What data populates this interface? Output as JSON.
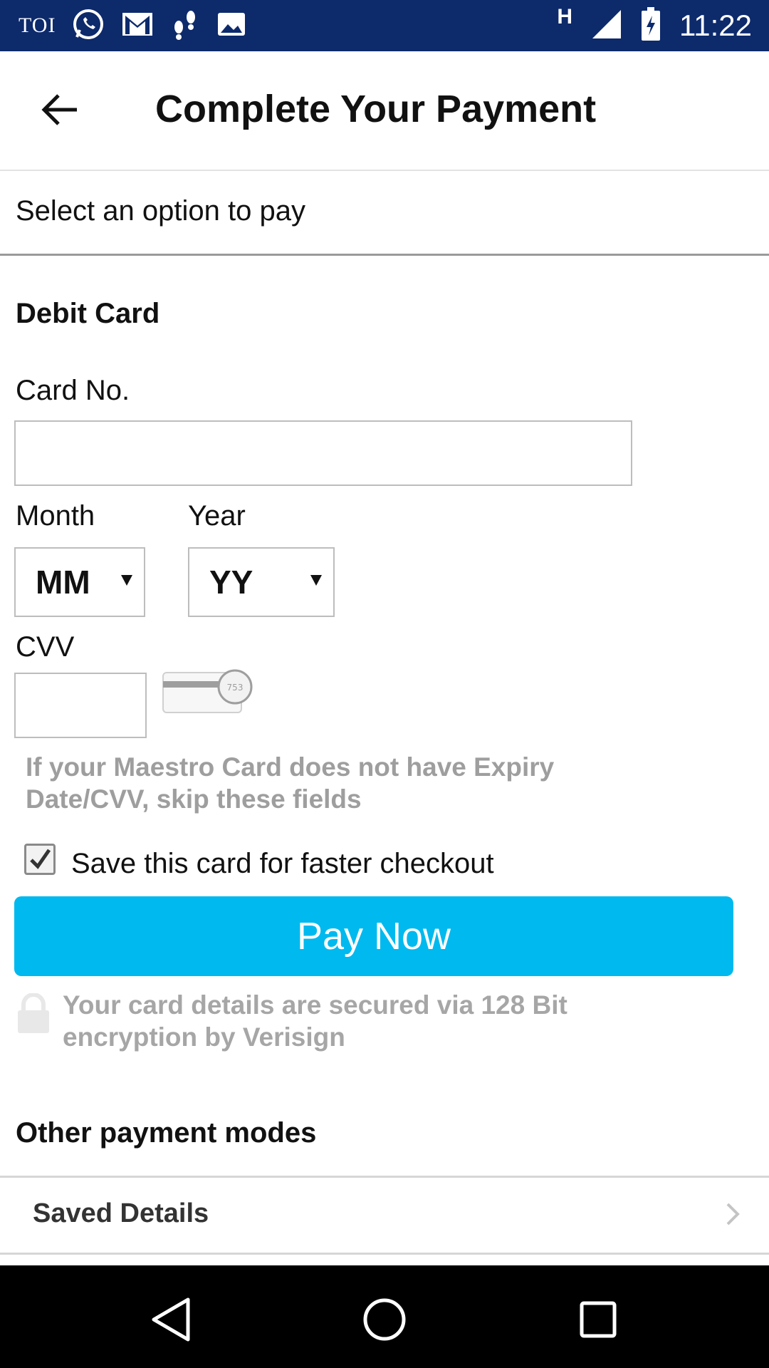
{
  "status_bar": {
    "app_label": "TOI",
    "network_type": "H",
    "time": "11:22",
    "icons": [
      "whatsapp-icon",
      "gmail-icon",
      "footsteps-icon",
      "image-icon",
      "signal-icon",
      "battery-charging-icon"
    ]
  },
  "header": {
    "title": "Complete Your Payment",
    "back_icon": "arrow-left-icon"
  },
  "instructions": "Select an option to pay",
  "debit_card": {
    "section_title": "Debit Card",
    "card_no_label": "Card No.",
    "card_no_value": "",
    "month_label": "Month",
    "month_value": "MM",
    "year_label": "Year",
    "year_value": "YY",
    "cvv_label": "CVV",
    "cvv_value": "",
    "cvv_hint_text": "753",
    "maestro_note": "If your Maestro Card does not have Expiry Date/CVV, skip these fields",
    "save_card_label": "Save this card for faster checkout",
    "save_card_checked": true,
    "pay_button_label": "Pay Now",
    "security_note": "Your card details are secured via 128 Bit encryption by Verisign"
  },
  "other_modes": {
    "title": "Other payment modes",
    "items": [
      {
        "label": "Saved Details"
      }
    ]
  },
  "nav_bar": {
    "buttons": [
      "back-triangle-icon",
      "home-circle-icon",
      "recents-square-icon"
    ]
  },
  "colors": {
    "status_bar": "#0d2a6b",
    "pay_button": "#00b9ee",
    "muted_text": "#9e9e9e",
    "nav_bar": "#000000"
  }
}
